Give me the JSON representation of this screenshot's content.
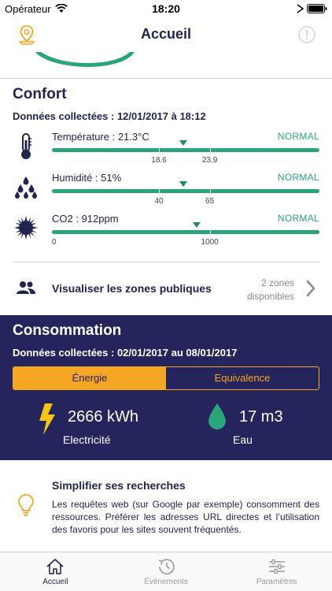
{
  "status_bar": {
    "carrier": "Opérateur",
    "time": "18:20"
  },
  "header": {
    "title": "Accueil",
    "left_icon": "map-pin-icon",
    "right_icon": "info-icon"
  },
  "confort": {
    "title": "Confort",
    "collected": "Données collectées : 12/01/2017 à 18:12",
    "metrics": [
      {
        "icon": "thermometer-icon",
        "label": "Température : 21.3°C",
        "status": "NORMAL",
        "ticks": [
          "18.6",
          "23.9"
        ],
        "level": 0.49
      },
      {
        "icon": "humidity-drops-icon",
        "label": "Humidité : 51%",
        "status": "NORMAL",
        "ticks": [
          "40",
          "65"
        ],
        "level": 0.49
      },
      {
        "icon": "co2-icon",
        "label": "CO2 : 912ppm",
        "status": "NORMAL",
        "ticks": [
          "0",
          "1000"
        ],
        "level": 0.54
      }
    ]
  },
  "zones": {
    "label": "Visualiser les zones publiques",
    "count_line1": "2 zones",
    "count_line2": "disponibles"
  },
  "consommation": {
    "title": "Consommation",
    "collected": "Données collectées : 02/01/2017 au 08/01/2017",
    "tabs": {
      "active": "Énergie",
      "inactive": "Equivalence"
    },
    "electricity": {
      "icon": "lightning-icon",
      "value": "2666 kWh",
      "label": "Electricité",
      "color": "#f5c518"
    },
    "water": {
      "icon": "water-drop-icon",
      "value": "17 m3",
      "label": "Eau",
      "color": "#2aa57b"
    }
  },
  "tip": {
    "icon": "lightbulb-icon",
    "title": "Simplifier ses recherches",
    "text": "Les requêtes web (sur Google par exemple) consomment des ressources. Préférer les adresses URL directes et l’utilisation des favoris pour les sites souvent fréquentés."
  },
  "tabbar": [
    {
      "label": "Accueil",
      "icon": "home-icon",
      "active": true
    },
    {
      "label": "Événements",
      "icon": "clock-history-icon",
      "active": false
    },
    {
      "label": "Paramètres",
      "icon": "sliders-icon",
      "active": false
    }
  ],
  "colors": {
    "navy": "#232350",
    "conso_bg": "#25245c",
    "green": "#2aa57b",
    "orange": "#f5a623"
  }
}
